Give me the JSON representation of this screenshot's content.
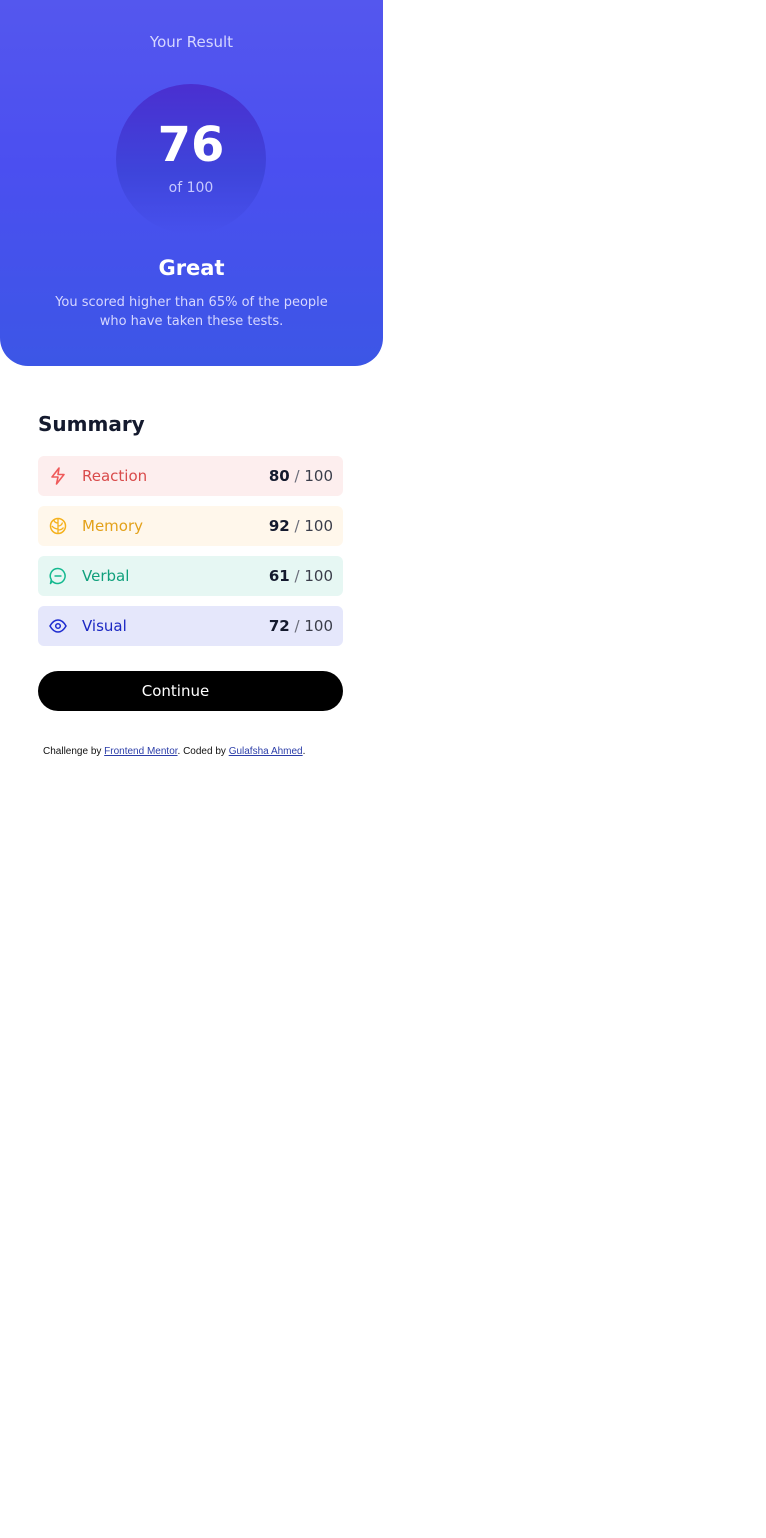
{
  "result": {
    "heading": "Your Result",
    "score": "76",
    "total": "of 100",
    "rating": "Great",
    "description": "You scored higher than 65% of the people who have taken these tests."
  },
  "summary": {
    "title": "Summary",
    "separator": "/",
    "items": [
      {
        "label": "Reaction",
        "score": "80",
        "max": "100",
        "icon": "lightning-icon",
        "color": "#ef5a5a"
      },
      {
        "label": "Memory",
        "score": "92",
        "max": "100",
        "icon": "brain-icon",
        "color": "#f5b11c"
      },
      {
        "label": "Verbal",
        "score": "61",
        "max": "100",
        "icon": "chat-bubble-icon",
        "color": "#14b98f"
      },
      {
        "label": "Visual",
        "score": "72",
        "max": "100",
        "icon": "eye-icon",
        "color": "#1e2cd0"
      }
    ]
  },
  "actions": {
    "continue_label": "Continue"
  },
  "footer": {
    "prefix": "Challenge by",
    "link1": "Frontend Mentor",
    "middle": ". Coded by",
    "link2": "Gulafsha Ahmed",
    "suffix": "."
  },
  "colors": {
    "accent_gradient_top": "#5457ee",
    "accent_gradient_bottom": "#3c56e6",
    "button": "#000000"
  }
}
